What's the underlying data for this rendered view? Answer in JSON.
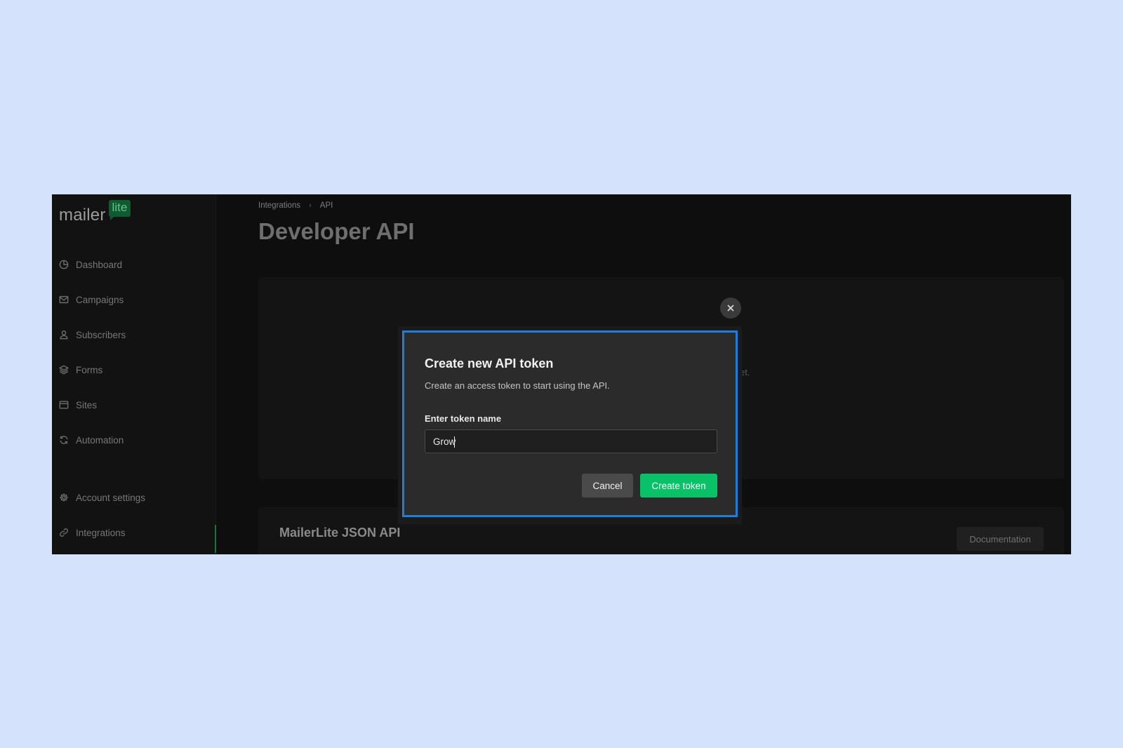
{
  "logo": {
    "word": "mailer",
    "badge": "lite"
  },
  "sidebar": {
    "items": [
      {
        "label": "Dashboard",
        "icon": "dashboard-icon"
      },
      {
        "label": "Campaigns",
        "icon": "mail-icon"
      },
      {
        "label": "Subscribers",
        "icon": "user-icon"
      },
      {
        "label": "Forms",
        "icon": "layers-icon"
      },
      {
        "label": "Sites",
        "icon": "browser-icon"
      },
      {
        "label": "Automation",
        "icon": "refresh-icon"
      },
      {
        "label": "Account settings",
        "icon": "gear-icon"
      },
      {
        "label": "Integrations",
        "icon": "link-icon"
      }
    ],
    "active": "Integrations"
  },
  "breadcrumb": {
    "parent": "Integrations",
    "current": "API"
  },
  "page": {
    "title": "Developer API",
    "card_hint": "et."
  },
  "json_api": {
    "title": "MailerLite JSON API",
    "doc_button": "Documentation"
  },
  "modal": {
    "title": "Create new API token",
    "subtitle": "Create an access token to start using the API.",
    "label": "Enter token name",
    "input_value": "Grow",
    "cancel": "Cancel",
    "create": "Create token"
  },
  "colors": {
    "accent": "#09c167",
    "focus_border": "#1b7fe0",
    "backdrop": "#d4e3fb"
  }
}
